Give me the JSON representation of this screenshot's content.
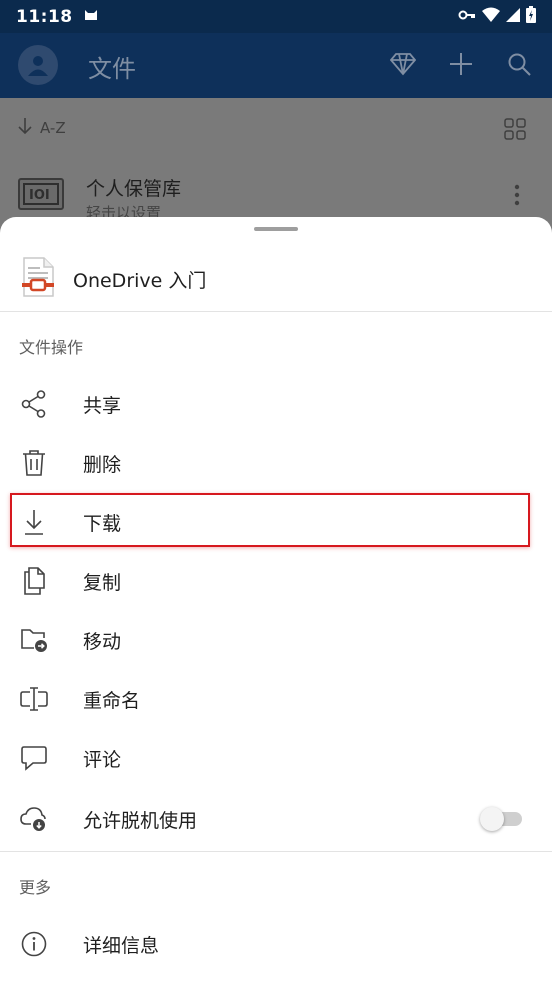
{
  "status_bar": {
    "time": "11:18"
  },
  "app_bar": {
    "title": "文件"
  },
  "list": {
    "sort_label": "A-Z",
    "vault": {
      "title": "个人保管库",
      "subtitle": "轻击以设置"
    }
  },
  "sheet": {
    "file_name": "OneDrive 入门",
    "section_file_ops": "文件操作",
    "items": [
      {
        "label": "共享",
        "icon": "share-icon"
      },
      {
        "label": "删除",
        "icon": "trash-icon"
      },
      {
        "label": "下载",
        "icon": "download-icon"
      },
      {
        "label": "复制",
        "icon": "copy-icon"
      },
      {
        "label": "移动",
        "icon": "move-folder-icon"
      },
      {
        "label": "重命名",
        "icon": "rename-icon"
      },
      {
        "label": "评论",
        "icon": "comment-icon"
      },
      {
        "label": "允许脱机使用",
        "icon": "offline-icon",
        "toggle": false
      }
    ],
    "section_more": "更多",
    "details_label": "详细信息"
  },
  "colors": {
    "appbar": "#0e305a",
    "highlight": "#d6181e",
    "file_accent": "#d24726"
  }
}
